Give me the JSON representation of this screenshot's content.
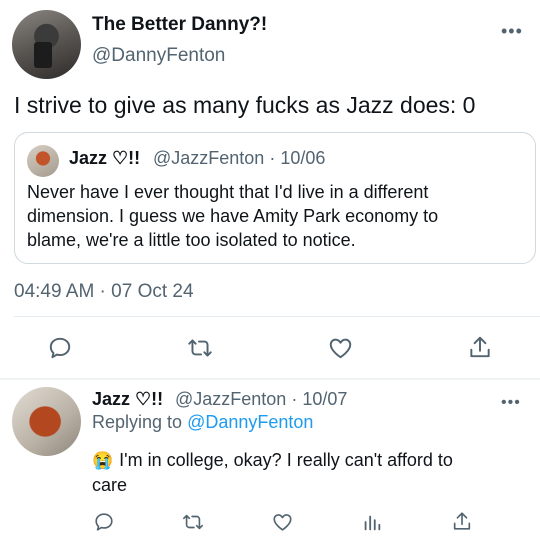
{
  "tweet": {
    "display_name": "The Better Danny?!",
    "handle": "@DannyFenton",
    "text": "I strive to give as many fucks as Jazz does: 0",
    "timestamp": "04:49 AM · 07 Oct 24",
    "more_icon": "ellipsis-icon"
  },
  "quoted": {
    "display_name": "Jazz ♡!!",
    "handle_date": "@JazzFenton · 10/06",
    "text_lines": [
      "Never have I ever thought that I'd live in a different",
      "dimension. I guess we have Amity Park economy to",
      "blame, we're a little too isolated to notice."
    ]
  },
  "actions": [
    "reply-icon",
    "retweet-icon",
    "like-icon",
    "share-icon"
  ],
  "reply": {
    "display_name": "Jazz ♡!!",
    "handle_date": "@JazzFenton · 10/07",
    "replying_prefix": "Replying to",
    "replying_handle": "@DannyFenton",
    "emoji": "😭",
    "text_line1": "I'm in college, okay? I really can't afford to",
    "text_line2": "care",
    "actions": [
      "reply-icon",
      "retweet-icon",
      "like-icon",
      "analytics-icon",
      "share-icon"
    ]
  },
  "colors": {
    "link": "#1d9bf0",
    "muted": "#536471",
    "text": "#0f1419"
  }
}
